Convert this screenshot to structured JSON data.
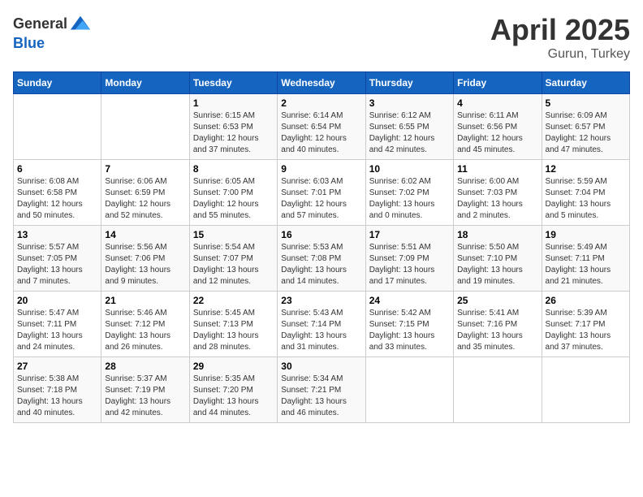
{
  "header": {
    "logo_general": "General",
    "logo_blue": "Blue",
    "month": "April 2025",
    "location": "Gurun, Turkey"
  },
  "weekdays": [
    "Sunday",
    "Monday",
    "Tuesday",
    "Wednesday",
    "Thursday",
    "Friday",
    "Saturday"
  ],
  "weeks": [
    [
      {
        "day": "",
        "info": ""
      },
      {
        "day": "",
        "info": ""
      },
      {
        "day": "1",
        "info": "Sunrise: 6:15 AM\nSunset: 6:53 PM\nDaylight: 12 hours\nand 37 minutes."
      },
      {
        "day": "2",
        "info": "Sunrise: 6:14 AM\nSunset: 6:54 PM\nDaylight: 12 hours\nand 40 minutes."
      },
      {
        "day": "3",
        "info": "Sunrise: 6:12 AM\nSunset: 6:55 PM\nDaylight: 12 hours\nand 42 minutes."
      },
      {
        "day": "4",
        "info": "Sunrise: 6:11 AM\nSunset: 6:56 PM\nDaylight: 12 hours\nand 45 minutes."
      },
      {
        "day": "5",
        "info": "Sunrise: 6:09 AM\nSunset: 6:57 PM\nDaylight: 12 hours\nand 47 minutes."
      }
    ],
    [
      {
        "day": "6",
        "info": "Sunrise: 6:08 AM\nSunset: 6:58 PM\nDaylight: 12 hours\nand 50 minutes."
      },
      {
        "day": "7",
        "info": "Sunrise: 6:06 AM\nSunset: 6:59 PM\nDaylight: 12 hours\nand 52 minutes."
      },
      {
        "day": "8",
        "info": "Sunrise: 6:05 AM\nSunset: 7:00 PM\nDaylight: 12 hours\nand 55 minutes."
      },
      {
        "day": "9",
        "info": "Sunrise: 6:03 AM\nSunset: 7:01 PM\nDaylight: 12 hours\nand 57 minutes."
      },
      {
        "day": "10",
        "info": "Sunrise: 6:02 AM\nSunset: 7:02 PM\nDaylight: 13 hours\nand 0 minutes."
      },
      {
        "day": "11",
        "info": "Sunrise: 6:00 AM\nSunset: 7:03 PM\nDaylight: 13 hours\nand 2 minutes."
      },
      {
        "day": "12",
        "info": "Sunrise: 5:59 AM\nSunset: 7:04 PM\nDaylight: 13 hours\nand 5 minutes."
      }
    ],
    [
      {
        "day": "13",
        "info": "Sunrise: 5:57 AM\nSunset: 7:05 PM\nDaylight: 13 hours\nand 7 minutes."
      },
      {
        "day": "14",
        "info": "Sunrise: 5:56 AM\nSunset: 7:06 PM\nDaylight: 13 hours\nand 9 minutes."
      },
      {
        "day": "15",
        "info": "Sunrise: 5:54 AM\nSunset: 7:07 PM\nDaylight: 13 hours\nand 12 minutes."
      },
      {
        "day": "16",
        "info": "Sunrise: 5:53 AM\nSunset: 7:08 PM\nDaylight: 13 hours\nand 14 minutes."
      },
      {
        "day": "17",
        "info": "Sunrise: 5:51 AM\nSunset: 7:09 PM\nDaylight: 13 hours\nand 17 minutes."
      },
      {
        "day": "18",
        "info": "Sunrise: 5:50 AM\nSunset: 7:10 PM\nDaylight: 13 hours\nand 19 minutes."
      },
      {
        "day": "19",
        "info": "Sunrise: 5:49 AM\nSunset: 7:11 PM\nDaylight: 13 hours\nand 21 minutes."
      }
    ],
    [
      {
        "day": "20",
        "info": "Sunrise: 5:47 AM\nSunset: 7:11 PM\nDaylight: 13 hours\nand 24 minutes."
      },
      {
        "day": "21",
        "info": "Sunrise: 5:46 AM\nSunset: 7:12 PM\nDaylight: 13 hours\nand 26 minutes."
      },
      {
        "day": "22",
        "info": "Sunrise: 5:45 AM\nSunset: 7:13 PM\nDaylight: 13 hours\nand 28 minutes."
      },
      {
        "day": "23",
        "info": "Sunrise: 5:43 AM\nSunset: 7:14 PM\nDaylight: 13 hours\nand 31 minutes."
      },
      {
        "day": "24",
        "info": "Sunrise: 5:42 AM\nSunset: 7:15 PM\nDaylight: 13 hours\nand 33 minutes."
      },
      {
        "day": "25",
        "info": "Sunrise: 5:41 AM\nSunset: 7:16 PM\nDaylight: 13 hours\nand 35 minutes."
      },
      {
        "day": "26",
        "info": "Sunrise: 5:39 AM\nSunset: 7:17 PM\nDaylight: 13 hours\nand 37 minutes."
      }
    ],
    [
      {
        "day": "27",
        "info": "Sunrise: 5:38 AM\nSunset: 7:18 PM\nDaylight: 13 hours\nand 40 minutes."
      },
      {
        "day": "28",
        "info": "Sunrise: 5:37 AM\nSunset: 7:19 PM\nDaylight: 13 hours\nand 42 minutes."
      },
      {
        "day": "29",
        "info": "Sunrise: 5:35 AM\nSunset: 7:20 PM\nDaylight: 13 hours\nand 44 minutes."
      },
      {
        "day": "30",
        "info": "Sunrise: 5:34 AM\nSunset: 7:21 PM\nDaylight: 13 hours\nand 46 minutes."
      },
      {
        "day": "",
        "info": ""
      },
      {
        "day": "",
        "info": ""
      },
      {
        "day": "",
        "info": ""
      }
    ]
  ]
}
